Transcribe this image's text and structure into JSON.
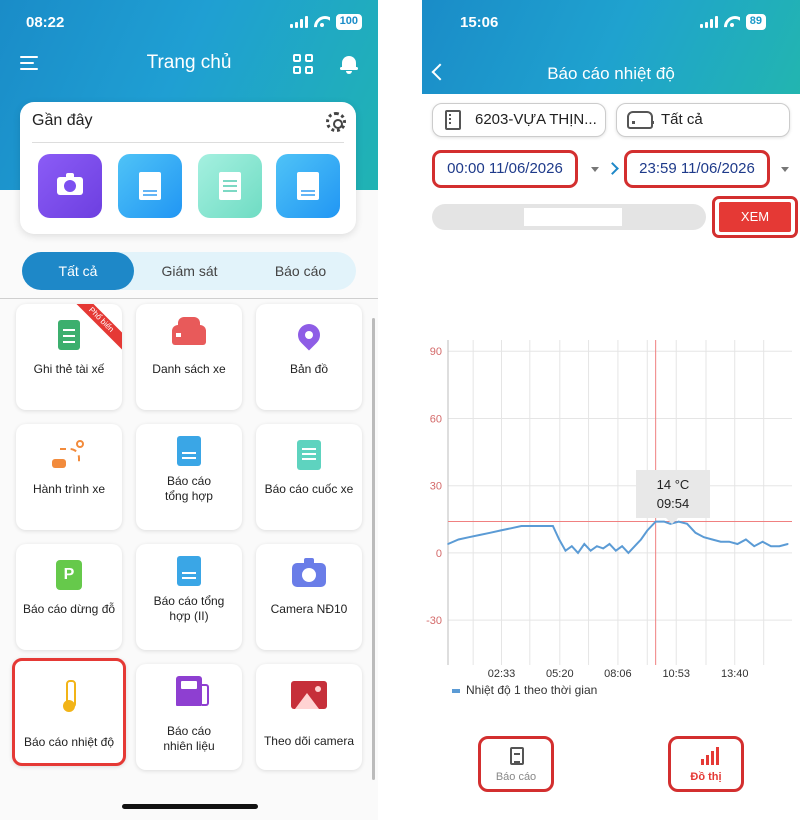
{
  "left": {
    "status": {
      "time": "08:22",
      "battery": "100"
    },
    "header": {
      "title": "Trang chủ"
    },
    "recent": {
      "label": "Gần đây"
    },
    "tabs": [
      "Tất cả",
      "Giám sát",
      "Báo cáo"
    ],
    "tiles": [
      {
        "label": "Ghi thẻ tài xế",
        "ribbon": "Phổ biến"
      },
      {
        "label": "Danh sách xe"
      },
      {
        "label": "Bản đồ"
      },
      {
        "label": "Hành trình xe"
      },
      {
        "label": "Báo cáo tổng hợp"
      },
      {
        "label": "Báo cáo cuốc xe"
      },
      {
        "label": "Báo cáo dừng đỗ"
      },
      {
        "label": "Báo cáo tổng hợp (II)"
      },
      {
        "label": "Camera NĐ10"
      },
      {
        "label": "Báo cáo nhiệt độ"
      },
      {
        "label": "Báo cáo nhiên liệu"
      },
      {
        "label": "Theo dõi camera"
      }
    ],
    "colors": {
      "accent": "#1e88c8",
      "highlight": "#e53935"
    }
  },
  "right": {
    "status": {
      "time": "15:06",
      "battery": "89"
    },
    "header": {
      "title": "Báo cáo nhiệt độ"
    },
    "vehicle": "6203-VỰA THỊN...",
    "filter": "Tất cả",
    "from": "00:00 11/06/2026",
    "to": "23:59 11/06/2026",
    "view_button": "XEM",
    "tooltip": {
      "value": "14 °C",
      "time": "09:54"
    },
    "legend": "Nhiệt độ 1 theo thời gian",
    "bottom_tabs": {
      "report": "Báo cáo",
      "chart": "Đồ thị"
    }
  },
  "chart_data": {
    "type": "line",
    "yticks": [
      90,
      60,
      30,
      0,
      -30
    ],
    "xticks": [
      "02:33",
      "05:20",
      "08:06",
      "10:53",
      "13:40"
    ],
    "ylim": [
      -50,
      95
    ],
    "xlim": [
      0,
      16.4
    ],
    "reference_line": 14,
    "highlight_time": 9.9,
    "series": [
      {
        "name": "Nhiệt độ 1 theo thời gian",
        "x": [
          0,
          0.5,
          1,
          1.5,
          2,
          2.5,
          3,
          3.5,
          4,
          4.5,
          5,
          5.3,
          5.6,
          5.9,
          6.2,
          6.5,
          6.8,
          7.1,
          7.4,
          7.7,
          8.0,
          8.3,
          8.6,
          8.9,
          9.2,
          9.5,
          9.9,
          10.3,
          10.6,
          11.0,
          11.4,
          11.8,
          12.2,
          12.6,
          13.0,
          13.4,
          13.8,
          14.2,
          14.6,
          15.0,
          15.4,
          15.8,
          16.2
        ],
        "y": [
          4,
          6,
          7,
          8,
          9,
          10,
          11,
          12,
          12,
          12,
          12,
          6,
          1,
          3,
          0,
          4,
          1,
          3,
          2,
          4,
          1,
          3,
          0,
          3,
          6,
          10,
          14,
          14,
          13,
          14,
          13,
          9,
          7,
          6,
          5,
          5,
          4,
          6,
          3,
          5,
          3,
          3,
          4
        ]
      }
    ]
  }
}
